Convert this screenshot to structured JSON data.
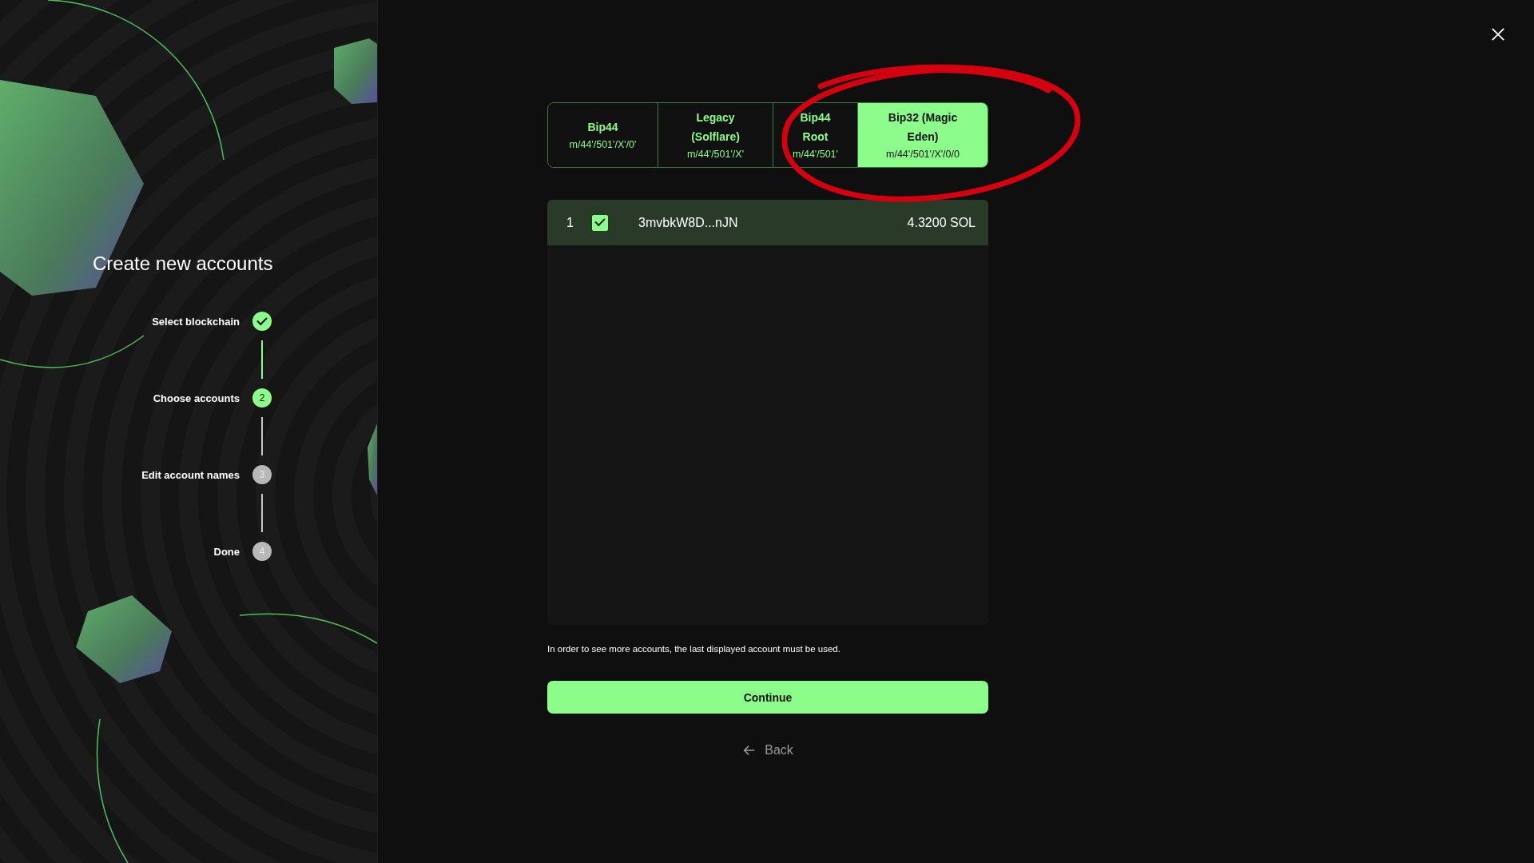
{
  "sidebar": {
    "title": "Create new accounts",
    "steps": [
      {
        "label": "Select blockchain",
        "completed": true,
        "reached": true
      },
      {
        "label": "Choose accounts",
        "completed": false,
        "reached": true,
        "number": "2"
      },
      {
        "label": "Edit account names",
        "completed": false,
        "reached": false,
        "number": "3"
      },
      {
        "label": "Done",
        "completed": false,
        "reached": false,
        "number": "4"
      }
    ]
  },
  "tabs": [
    {
      "label": "Bip44",
      "path": "m/44'/501'/X'/0'",
      "selected": false
    },
    {
      "label": "Legacy (Solflare)",
      "path": "m/44'/501'/X'",
      "selected": false
    },
    {
      "label": "Bip44 Root",
      "path": "m/44'/501'",
      "selected": false
    },
    {
      "label": "Bip32 (Magic Eden)",
      "path": "m/44'/501'/X'/0/0",
      "selected": true
    }
  ],
  "accounts": [
    {
      "index": "1",
      "checked": true,
      "address": "3mvbkW8D...nJN",
      "balance": "4.3200 SOL"
    }
  ],
  "note": "In order to see more accounts, the last displayed account must be used.",
  "continue_button": "Continue",
  "back_link": "Back"
}
